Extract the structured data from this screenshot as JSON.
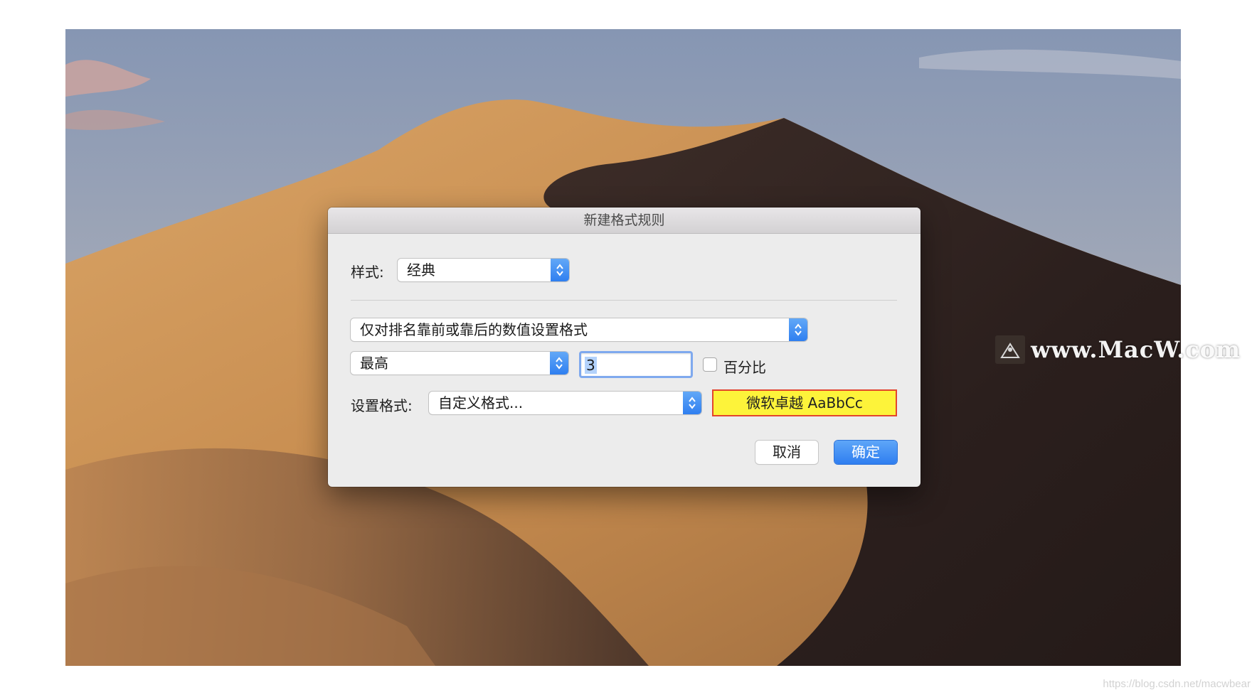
{
  "watermark": {
    "text": "www.MacW.com",
    "url": "https://blog.csdn.net/macwbear"
  },
  "dialog": {
    "title": "新建格式规则",
    "style_label": "样式:",
    "style_value": "经典",
    "rule_type_value": "仅对排名靠前或靠后的数值设置格式",
    "rank_value": "最高",
    "count_value": "3",
    "percent_label": "百分比",
    "percent_checked": false,
    "format_label": "设置格式:",
    "format_value": "自定义格式...",
    "preview_text": "微软卓越  AaBbCc",
    "cancel_label": "取消",
    "ok_label": "确定"
  },
  "colors": {
    "accent": "#2f7ff0",
    "preview_fill": "#fdf33a",
    "preview_border": "#e3452c"
  },
  "icons": {
    "popup_arrows": "up-down-chevron-icon",
    "watermark_logo": "macw-logo-icon"
  }
}
